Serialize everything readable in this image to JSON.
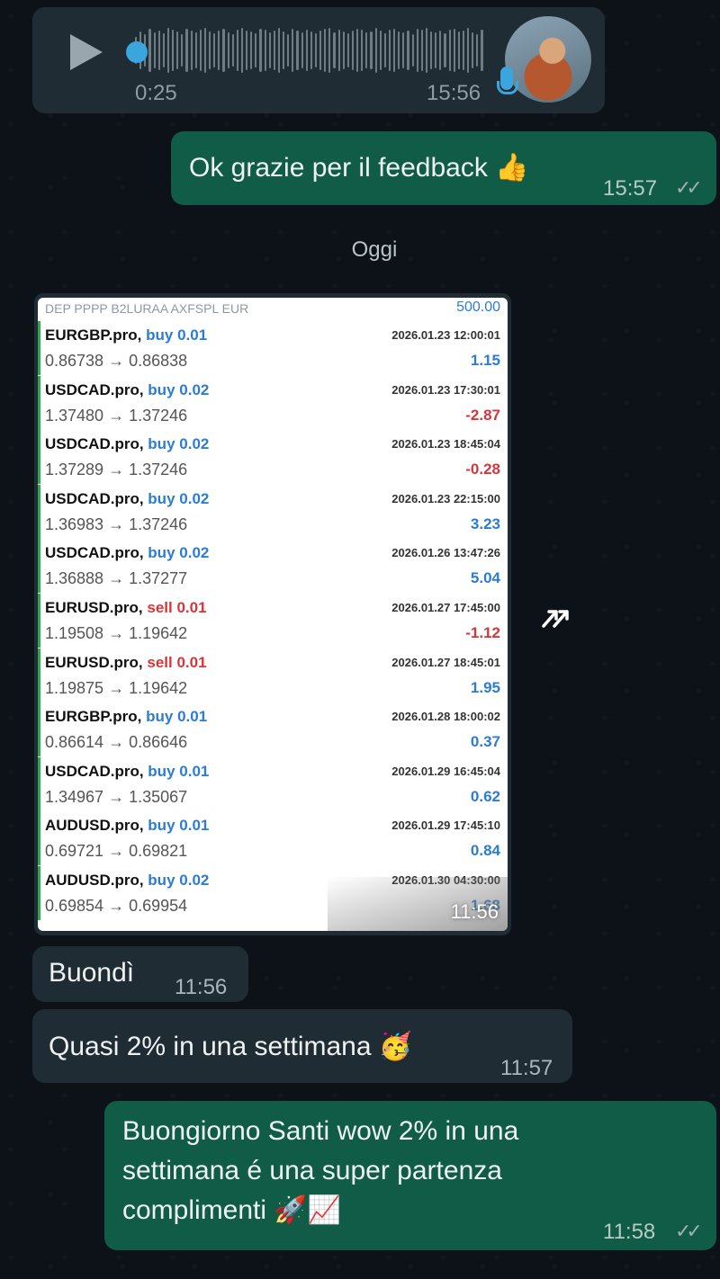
{
  "voice_message": {
    "duration": "0:25",
    "time": "15:56"
  },
  "msg_ok": {
    "text": "Ok grazie per il feedback 👍",
    "time": "15:57",
    "status": "✓✓"
  },
  "date_separator": "Oggi",
  "screenshot": {
    "header_left": "DEP PPPP B2LURAA AXFSPL EUR",
    "header_right": "500.00",
    "time": "11:56",
    "trades": [
      {
        "symbol": "EURGBP.pro,",
        "side": "buy",
        "lot": "0.01",
        "prices": "0.86738 → 0.86838",
        "datetime": "2026.01.23 12:00:01",
        "pl": "1.15",
        "pl_sign": "pos"
      },
      {
        "symbol": "USDCAD.pro,",
        "side": "buy",
        "lot": "0.02",
        "prices": "1.37480 → 1.37246",
        "datetime": "2026.01.23 17:30:01",
        "pl": "-2.87",
        "pl_sign": "neg"
      },
      {
        "symbol": "USDCAD.pro,",
        "side": "buy",
        "lot": "0.02",
        "prices": "1.37289 → 1.37246",
        "datetime": "2026.01.23 18:45:04",
        "pl": "-0.28",
        "pl_sign": "neg"
      },
      {
        "symbol": "USDCAD.pro,",
        "side": "buy",
        "lot": "0.02",
        "prices": "1.36983 → 1.37246",
        "datetime": "2026.01.23 22:15:00",
        "pl": "3.23",
        "pl_sign": "pos"
      },
      {
        "symbol": "USDCAD.pro,",
        "side": "buy",
        "lot": "0.02",
        "prices": "1.36888 → 1.37277",
        "datetime": "2026.01.26 13:47:26",
        "pl": "5.04",
        "pl_sign": "pos"
      },
      {
        "symbol": "EURUSD.pro,",
        "side": "sell",
        "lot": "0.01",
        "prices": "1.19508 → 1.19642",
        "datetime": "2026.01.27 17:45:00",
        "pl": "-1.12",
        "pl_sign": "neg"
      },
      {
        "symbol": "EURUSD.pro,",
        "side": "sell",
        "lot": "0.01",
        "prices": "1.19875 → 1.19642",
        "datetime": "2026.01.27 18:45:01",
        "pl": "1.95",
        "pl_sign": "pos"
      },
      {
        "symbol": "EURGBP.pro,",
        "side": "buy",
        "lot": "0.01",
        "prices": "0.86614 → 0.86646",
        "datetime": "2026.01.28 18:00:02",
        "pl": "0.37",
        "pl_sign": "pos"
      },
      {
        "symbol": "USDCAD.pro,",
        "side": "buy",
        "lot": "0.01",
        "prices": "1.34967 → 1.35067",
        "datetime": "2026.01.29 16:45:04",
        "pl": "0.62",
        "pl_sign": "pos"
      },
      {
        "symbol": "AUDUSD.pro,",
        "side": "buy",
        "lot": "0.01",
        "prices": "0.69721 → 0.69821",
        "datetime": "2026.01.29 17:45:10",
        "pl": "0.84",
        "pl_sign": "pos"
      },
      {
        "symbol": "AUDUSD.pro,",
        "side": "buy",
        "lot": "0.02",
        "prices": "0.69854 → 0.69954",
        "datetime": "2026.01.30 04:30:00",
        "pl": "1.68",
        "pl_sign": "pos"
      }
    ]
  },
  "msg_buondi": {
    "text": "Buondì",
    "time": "11:56"
  },
  "msg_quasi": {
    "text": "Quasi 2% in una settimana 🥳",
    "time": "11:57"
  },
  "msg_buongiorno": {
    "lines": [
      "Buongiorno Santi wow 2% in una",
      "settimana é una super partenza",
      "complimenti 🚀📈"
    ],
    "time": "11:58",
    "status": "✓✓"
  },
  "colors": {
    "incoming_bubble": "#1f2c33",
    "outgoing_bubble": "#105c47",
    "accent_blue": "#3aa6dd",
    "buy": "#2b7cd3",
    "sell": "#d9343a"
  },
  "icons": [
    "play-icon",
    "mic-icon",
    "double-check-icon",
    "forward-icon"
  ]
}
